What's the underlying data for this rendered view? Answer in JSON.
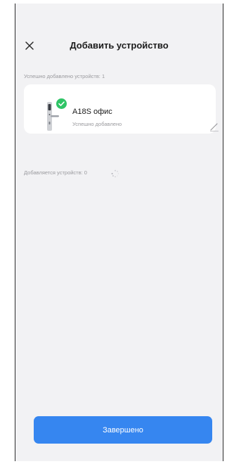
{
  "header": {
    "title": "Добавить устройство",
    "close_icon": "close-icon"
  },
  "added_section": {
    "label": "Успешно добавлено устройств: 1"
  },
  "device": {
    "name": "A18S офис",
    "status": "Успешно добавлено",
    "image_icon": "door-lock-icon",
    "badge_icon": "check-circle-icon",
    "edit_icon": "pencil-icon"
  },
  "adding_section": {
    "label": "Добавляется устройств: 0",
    "spinner_icon": "loading-spinner-icon"
  },
  "footer": {
    "done_label": "Завершено"
  },
  "colors": {
    "accent": "#3686f0",
    "success": "#2fc466",
    "background": "#f2f2f4",
    "card": "#ffffff"
  }
}
